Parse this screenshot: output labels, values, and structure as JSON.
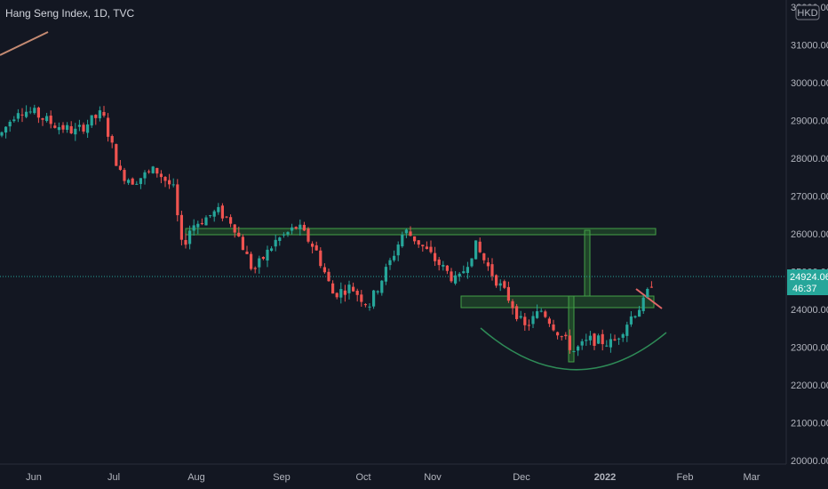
{
  "chart_title": "Hang Seng Index, 1D, TVC",
  "currency": "HKD",
  "last_price_label": "24924.06",
  "countdown_label": "46:37",
  "colors": {
    "background": "#131722",
    "up": "#26a69a",
    "down": "#ef5350",
    "zone_fill": "#2e7d32",
    "zone_stroke": "#43a047",
    "arc": "#2e8b57",
    "price_tag": "#26a69a",
    "trendline_top_left": "#c48a72",
    "trendline_red": "#e06666"
  },
  "chart_data": {
    "type": "candlestick",
    "title": "Hang Seng Index, 1D, TVC",
    "ylim": [
      20000,
      32000
    ],
    "y_ticks": [
      20000,
      21000,
      22000,
      23000,
      24000,
      25000,
      26000,
      27000,
      28000,
      29000,
      30000,
      31000,
      32000
    ],
    "x_tick_labels": [
      "Jun",
      "Jul",
      "Aug",
      "Sep",
      "Oct",
      "Nov",
      "Dec",
      "2022",
      "Feb",
      "Mar"
    ],
    "bold_x_ticks": [
      "2022"
    ],
    "last_price": 24924.06,
    "grid": false,
    "annotations": {
      "upper_resistance_zone": [
        26000,
        26150
      ],
      "lower_support_zone": [
        24100,
        24450
      ],
      "rounding_bottom_arc": true,
      "measured_move_arrows": true
    },
    "key_closes_approx": [
      {
        "month": "Jun",
        "price": 29000
      },
      {
        "month": "Jul",
        "price": 27300
      },
      {
        "month": "Aug",
        "price": 26200
      },
      {
        "month": "Sep",
        "price": 25200
      },
      {
        "month": "Oct",
        "price": 25400
      },
      {
        "month": "Nov",
        "price": 24800
      },
      {
        "month": "Dec",
        "price": 23000
      },
      {
        "month": "2022",
        "price": 23500
      },
      {
        "month": "Feb",
        "price": 24924.06
      }
    ]
  }
}
